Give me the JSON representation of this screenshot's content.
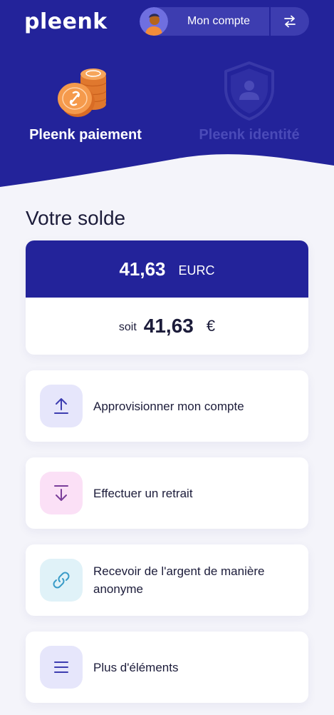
{
  "header": {
    "logo_text": "pleenk",
    "account_label": "Mon compte",
    "swap_icon": "swap-arrows-icon",
    "colors": {
      "primary": "#23239a",
      "pill": "#3d3db0",
      "background": "#f4f4fa"
    }
  },
  "tabs": [
    {
      "label": "Pleenk paiement",
      "icon": "coins-icon",
      "active": true
    },
    {
      "label": "Pleenk identité",
      "icon": "shield-user-icon",
      "active": false
    }
  ],
  "balance": {
    "title": "Votre solde",
    "amount": "41,63",
    "unit": "EURC",
    "converted_prefix": "soit",
    "converted_amount": "41,63",
    "converted_unit": "€"
  },
  "actions": [
    {
      "label": "Approvisionner mon compte",
      "icon": "upload-arrow-icon",
      "color": "#e6e6fb"
    },
    {
      "label": "Effectuer un retrait",
      "icon": "download-arrow-icon",
      "color": "#fbe0f6"
    },
    {
      "label": "Recevoir de l'argent de manière anonyme",
      "icon": "link-icon",
      "color": "#e0f2f8"
    },
    {
      "label": "Plus d'éléments",
      "icon": "menu-icon",
      "color": "#e6e6fb"
    }
  ]
}
